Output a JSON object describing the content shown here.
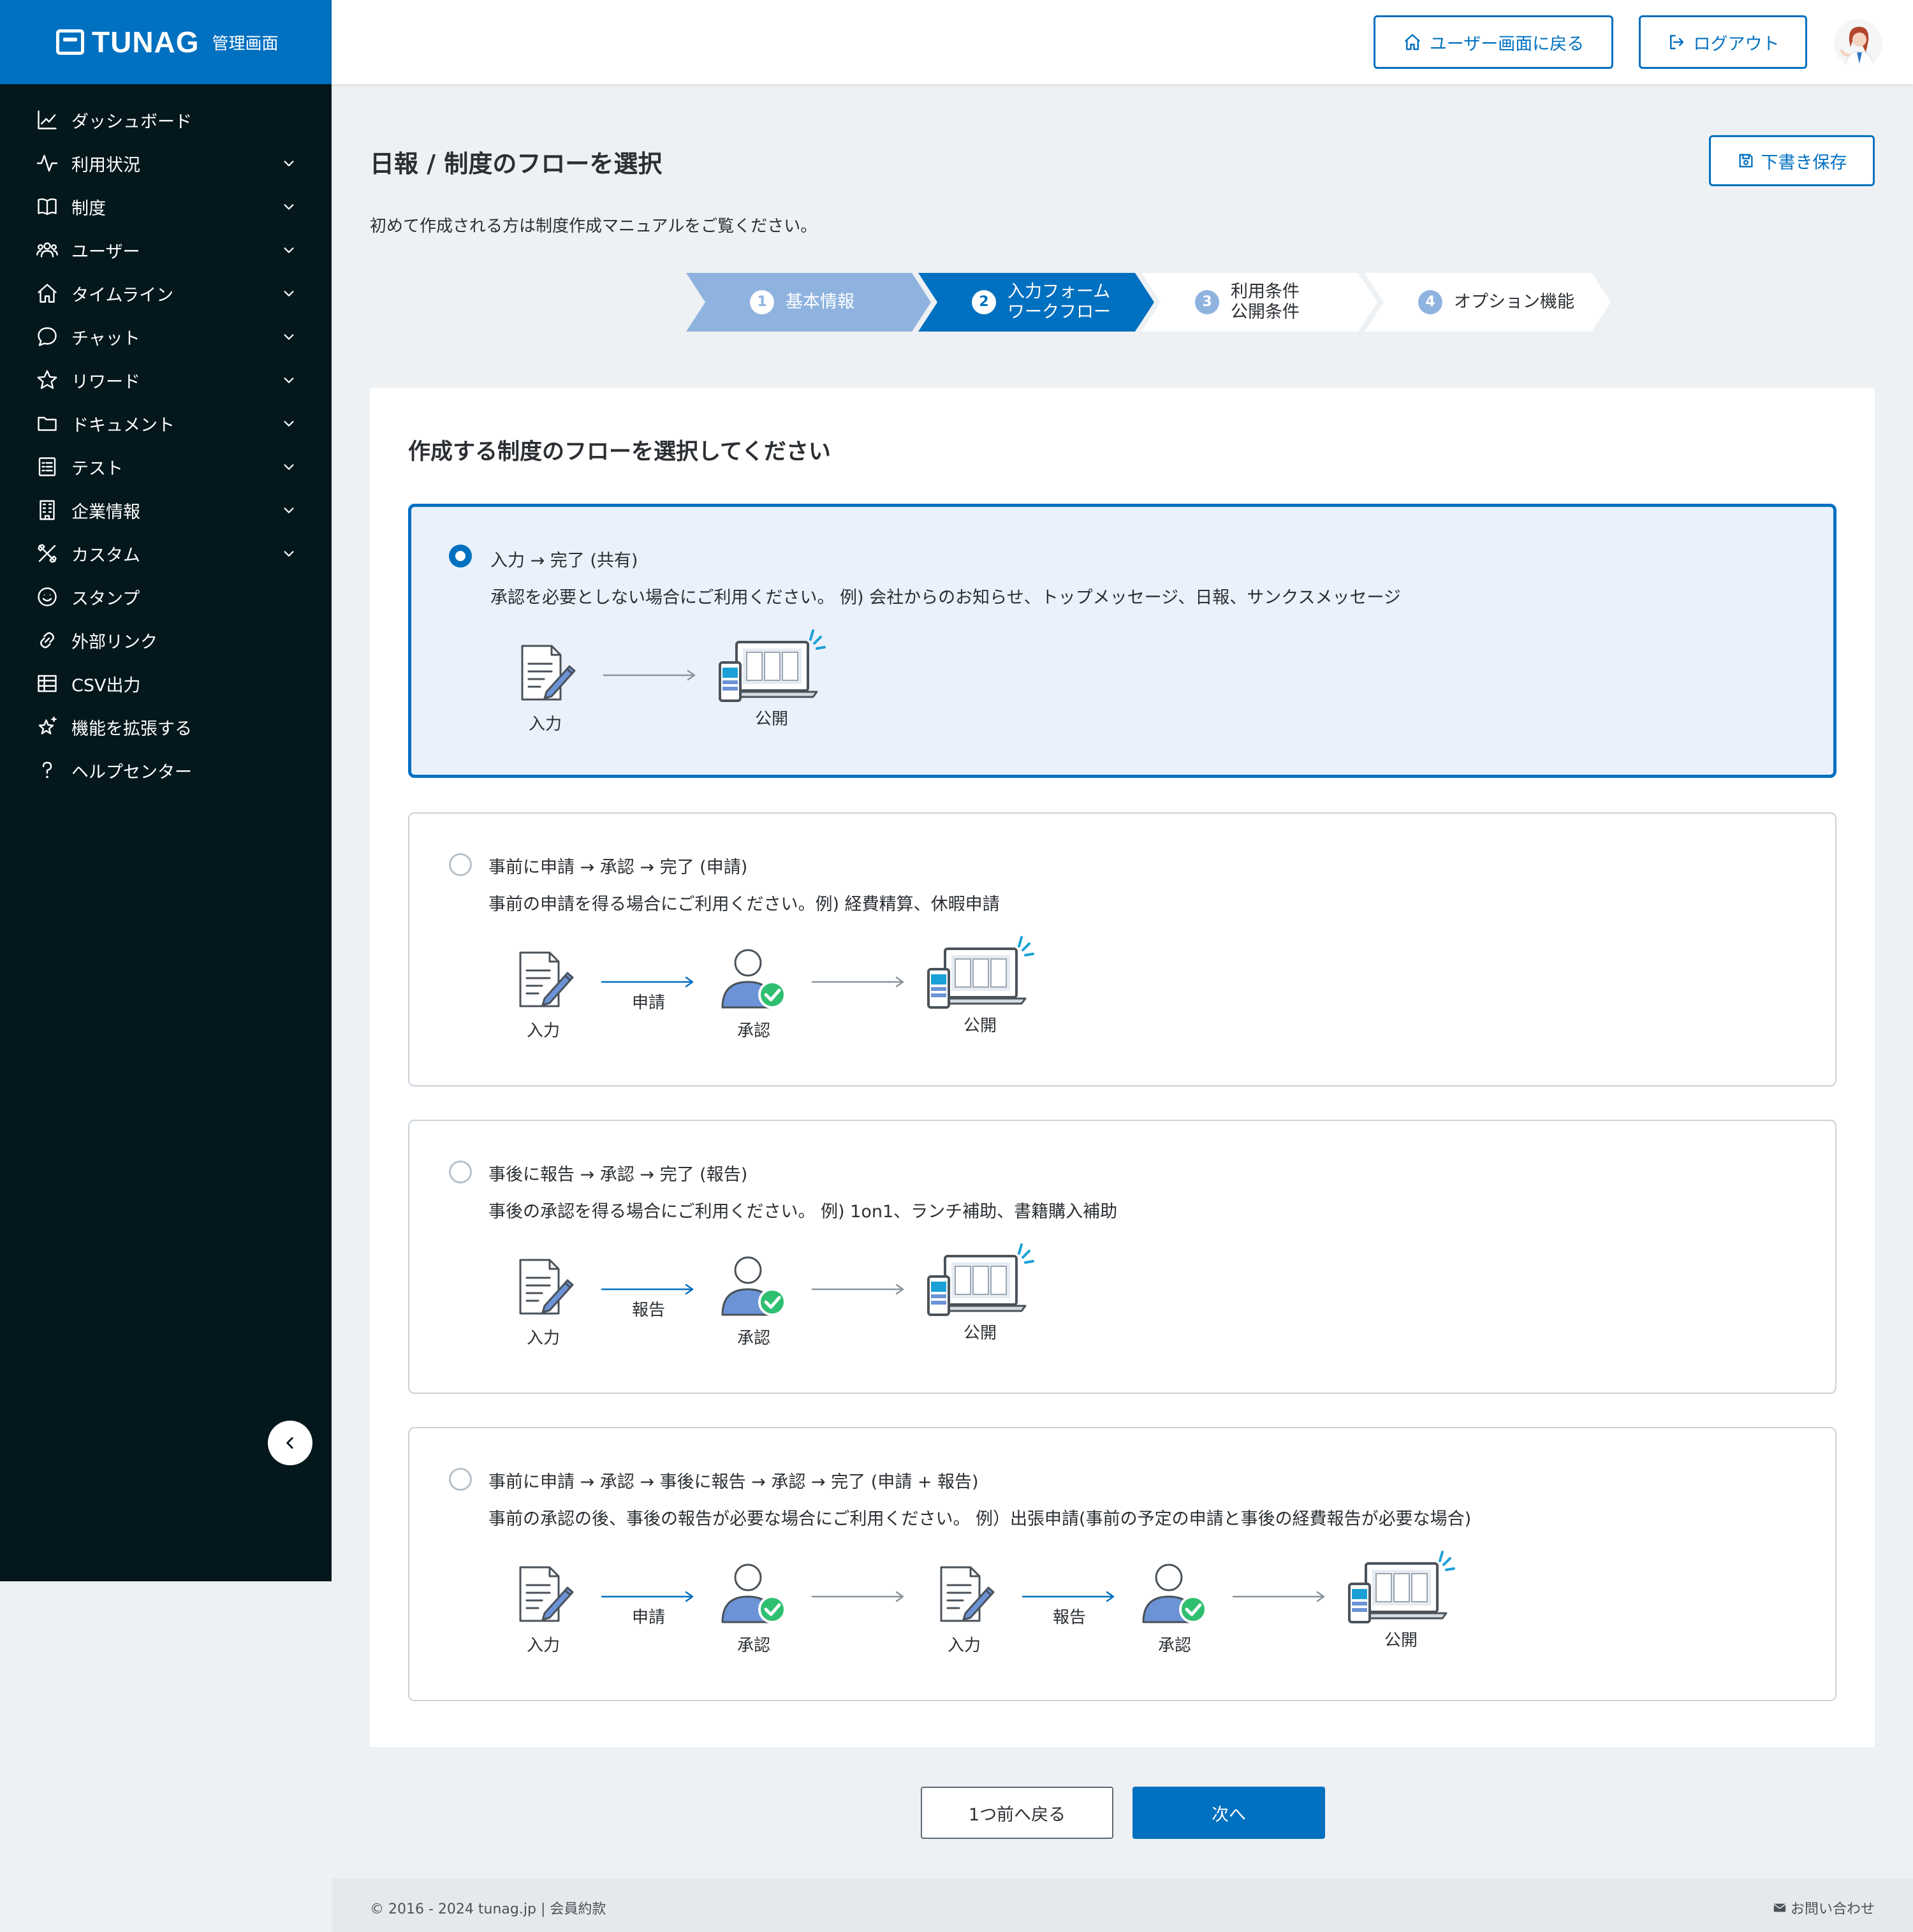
{
  "brand": {
    "name": "TUNAG",
    "sub": "管理画面"
  },
  "colors": {
    "primary": "#0070c0",
    "sidebar_bg": "#04171c",
    "step_done": "#8fb3df",
    "step_inactive": "#ffffff"
  },
  "sidebar": {
    "items": [
      {
        "label": "ダッシュボード",
        "icon": "chart-line-icon",
        "expandable": false
      },
      {
        "label": "利用状況",
        "icon": "activity-icon",
        "expandable": true
      },
      {
        "label": "制度",
        "icon": "book-icon",
        "expandable": true
      },
      {
        "label": "ユーザー",
        "icon": "users-icon",
        "expandable": true
      },
      {
        "label": "タイムライン",
        "icon": "home-icon",
        "expandable": true
      },
      {
        "label": "チャット",
        "icon": "chat-bubble-icon",
        "expandable": true
      },
      {
        "label": "リワード",
        "icon": "star-icon",
        "expandable": true
      },
      {
        "label": "ドキュメント",
        "icon": "folder-icon",
        "expandable": true
      },
      {
        "label": "テスト",
        "icon": "checklist-icon",
        "expandable": true
      },
      {
        "label": "企業情報",
        "icon": "building-icon",
        "expandable": true
      },
      {
        "label": "カスタム",
        "icon": "tools-icon",
        "expandable": true
      },
      {
        "label": "スタンプ",
        "icon": "smile-icon",
        "expandable": false
      },
      {
        "label": "外部リンク",
        "icon": "link-icon",
        "expandable": false
      },
      {
        "label": "CSV出力",
        "icon": "table-icon",
        "expandable": false
      },
      {
        "label": "機能を拡張する",
        "icon": "sparkle-star-icon",
        "expandable": false
      },
      {
        "label": "ヘルプセンター",
        "icon": "question-icon",
        "expandable": false
      }
    ]
  },
  "header": {
    "user_screen_button": "ユーザー画面に戻る",
    "logout_button": "ログアウト"
  },
  "page": {
    "title": "日報 / 制度のフローを選択",
    "draft_save": "下書き保存",
    "intro": "初めて作成される方は制度作成マニュアルをご覧ください。"
  },
  "steps": [
    {
      "num": "1",
      "line1": "基本情報",
      "line2": "",
      "state": "done"
    },
    {
      "num": "2",
      "line1": "入力フォーム",
      "line2": "ワークフロー",
      "state": "active"
    },
    {
      "num": "3",
      "line1": "利用条件",
      "line2": "公開条件",
      "state": "upcoming"
    },
    {
      "num": "4",
      "line1": "オプション機能",
      "line2": "",
      "state": "upcoming"
    }
  ],
  "card": {
    "title": "作成する制度のフローを選択してください",
    "options": [
      {
        "title": "入力 → 完了 (共有)",
        "desc": "承認を必要としない場合にご利用ください。 例) 会社からのお知らせ、トップメッセージ、日報、サンクスメッセージ",
        "selected": true,
        "flow": [
          {
            "kind": "node",
            "icon": "document-pen-icon",
            "label": "入力"
          },
          {
            "kind": "arrow",
            "label": ""
          },
          {
            "kind": "node",
            "icon": "publish-devices-icon",
            "label": "公開"
          }
        ]
      },
      {
        "title": "事前に申請 → 承認 → 完了 (申請)",
        "desc": "事前の申請を得る場合にご利用ください。例) 経費精算、休暇申請",
        "selected": false,
        "flow": [
          {
            "kind": "node",
            "icon": "document-pen-icon",
            "label": "入力"
          },
          {
            "kind": "arrow",
            "label": "申請"
          },
          {
            "kind": "node",
            "icon": "user-approve-icon",
            "label": "承認"
          },
          {
            "kind": "arrow",
            "label": ""
          },
          {
            "kind": "node",
            "icon": "publish-devices-icon",
            "label": "公開"
          }
        ]
      },
      {
        "title": "事後に報告 → 承認 → 完了 (報告)",
        "desc": "事後の承認を得る場合にご利用ください。 例) 1on1、ランチ補助、書籍購入補助",
        "selected": false,
        "flow": [
          {
            "kind": "node",
            "icon": "document-pen-icon",
            "label": "入力"
          },
          {
            "kind": "arrow",
            "label": "報告"
          },
          {
            "kind": "node",
            "icon": "user-approve-icon",
            "label": "承認"
          },
          {
            "kind": "arrow",
            "label": ""
          },
          {
            "kind": "node",
            "icon": "publish-devices-icon",
            "label": "公開"
          }
        ]
      },
      {
        "title": "事前に申請 → 承認 → 事後に報告 → 承認 → 完了 (申請 + 報告)",
        "desc": "事前の承認の後、事後の報告が必要な場合にご利用ください。 例）出張申請(事前の予定の申請と事後の経費報告が必要な場合)",
        "selected": false,
        "flow": [
          {
            "kind": "node",
            "icon": "document-pen-icon",
            "label": "入力"
          },
          {
            "kind": "arrow",
            "label": "申請"
          },
          {
            "kind": "node",
            "icon": "user-approve-icon",
            "label": "承認"
          },
          {
            "kind": "arrow",
            "label": ""
          },
          {
            "kind": "node",
            "icon": "document-pen-icon",
            "label": "入力"
          },
          {
            "kind": "arrow",
            "label": "報告"
          },
          {
            "kind": "node",
            "icon": "user-approve-icon",
            "label": "承認"
          },
          {
            "kind": "arrow",
            "label": ""
          },
          {
            "kind": "node",
            "icon": "publish-devices-icon",
            "label": "公開"
          }
        ]
      }
    ]
  },
  "actions": {
    "back": "1つ前へ戻る",
    "next": "次へ"
  },
  "footer": {
    "copyright": "© 2016 - 2024",
    "site": "tunag.jp",
    "separator": "|",
    "terms": "会員約款",
    "contact": "お問い合わせ"
  }
}
